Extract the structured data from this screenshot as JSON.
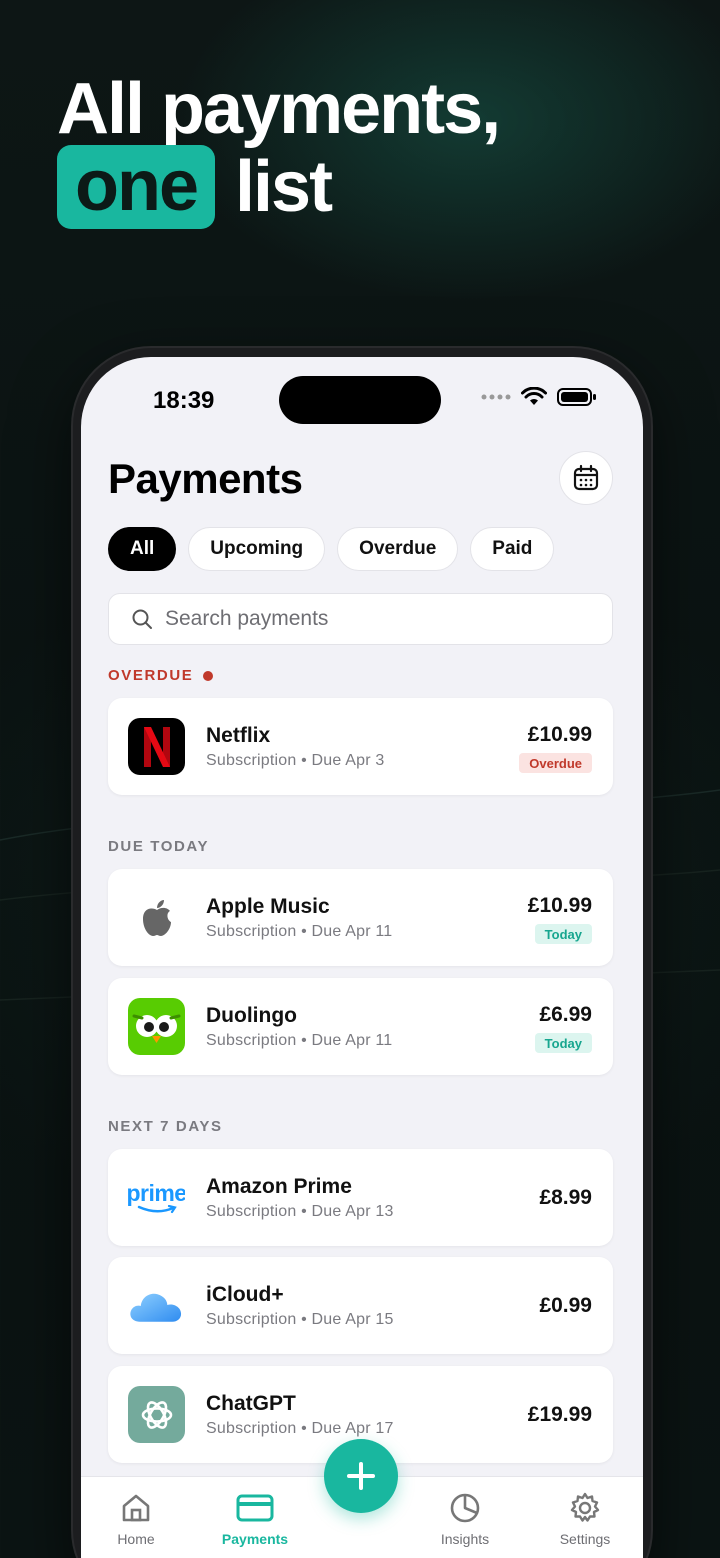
{
  "headline": {
    "line1": "All payments,",
    "highlight": "one",
    "line2_rest": "list"
  },
  "status": {
    "time": "18:39"
  },
  "header": {
    "title": "Payments"
  },
  "filters": [
    "All",
    "Upcoming",
    "Overdue",
    "Paid"
  ],
  "search": {
    "placeholder": "Search payments",
    "value": ""
  },
  "sections": {
    "overdue": "OVERDUE",
    "today": "DUE TODAY",
    "next7": "NEXT 7 DAYS"
  },
  "payments": [
    {
      "name": "Netflix",
      "meta": "Subscription • Due Apr 3",
      "amount": "£10.99",
      "badge": "Overdue"
    },
    {
      "name": "Apple Music",
      "meta": "Subscription • Due Apr 11",
      "amount": "£10.99",
      "badge": "Today"
    },
    {
      "name": "Duolingo",
      "meta": "Subscription • Due Apr 11",
      "amount": "£6.99",
      "badge": "Today"
    },
    {
      "name": "Amazon Prime",
      "meta": "Subscription • Due Apr 13",
      "amount": "£8.99"
    },
    {
      "name": "iCloud+",
      "meta": "Subscription • Due Apr 15",
      "amount": "£0.99"
    },
    {
      "name": "ChatGPT",
      "meta": "Subscription • Due Apr 17",
      "amount": "£19.99"
    }
  ],
  "logos": {
    "netflix": "N",
    "prime": "prime"
  },
  "tabs": [
    "Home",
    "Payments",
    "Insights",
    "Settings"
  ],
  "colors": {
    "accent": "#19b79f",
    "overdue": "#c0392b",
    "background": "#0b1413"
  }
}
